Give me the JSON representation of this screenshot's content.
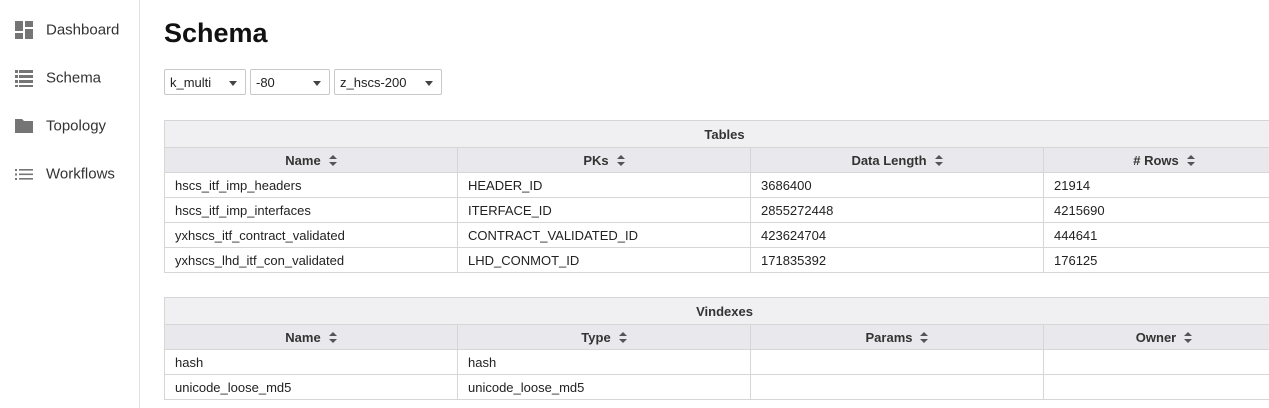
{
  "sidebar": {
    "items": [
      {
        "label": "Dashboard",
        "icon": "dashboard-icon"
      },
      {
        "label": "Schema",
        "icon": "list-view-icon"
      },
      {
        "label": "Topology",
        "icon": "folder-icon"
      },
      {
        "label": "Workflows",
        "icon": "list-icon"
      }
    ]
  },
  "page": {
    "title": "Schema"
  },
  "filters": [
    {
      "value": "k_multi"
    },
    {
      "value": "-80"
    },
    {
      "value": "z_hscs-200"
    }
  ],
  "tables": {
    "title": "Tables",
    "columns": [
      "Name",
      "PKs",
      "Data Length",
      "# Rows"
    ],
    "rows": [
      [
        "hscs_itf_imp_headers",
        "HEADER_ID",
        "3686400",
        "21914"
      ],
      [
        "hscs_itf_imp_interfaces",
        "ITERFACE_ID",
        "2855272448",
        "4215690"
      ],
      [
        "yxhscs_itf_contract_validated",
        "CONTRACT_VALIDATED_ID",
        "423624704",
        "444641"
      ],
      [
        "yxhscs_lhd_itf_con_validated",
        "LHD_CONMOT_ID",
        "171835392",
        "176125"
      ]
    ]
  },
  "vindexes": {
    "title": "Vindexes",
    "columns": [
      "Name",
      "Type",
      "Params",
      "Owner"
    ],
    "rows": [
      [
        "hash",
        "hash",
        "",
        ""
      ],
      [
        "unicode_loose_md5",
        "unicode_loose_md5",
        "",
        ""
      ]
    ]
  }
}
